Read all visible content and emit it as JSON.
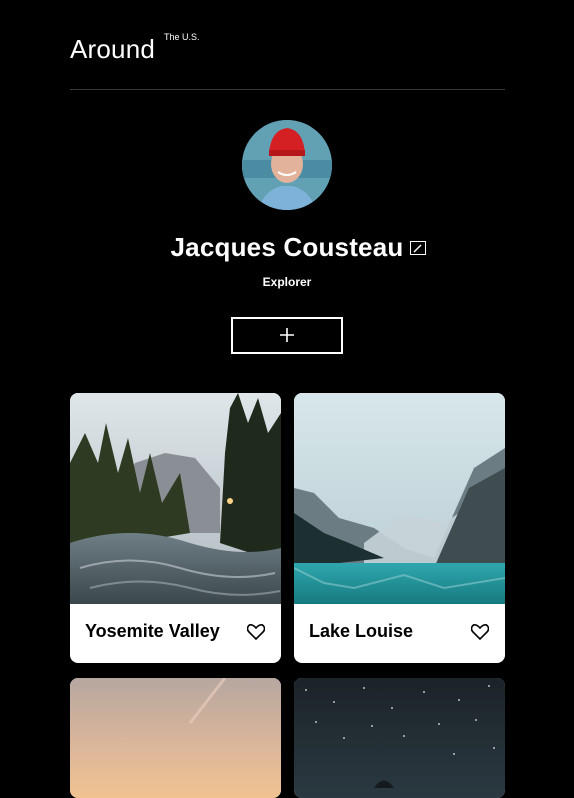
{
  "header": {
    "logo_text": "Around",
    "logo_sup": "The U.S."
  },
  "profile": {
    "name": "Jacques Cousteau",
    "job": "Explorer"
  },
  "icons": {
    "edit": "pencil-icon",
    "add": "plus-icon",
    "like": "heart-icon"
  },
  "cards": [
    {
      "title": "Yosemite Valley"
    },
    {
      "title": "Lake Louise"
    }
  ],
  "colors": {
    "background": "#000000",
    "card": "#ffffff",
    "text_on_dark": "#ffffff",
    "text_on_card": "#000000"
  }
}
